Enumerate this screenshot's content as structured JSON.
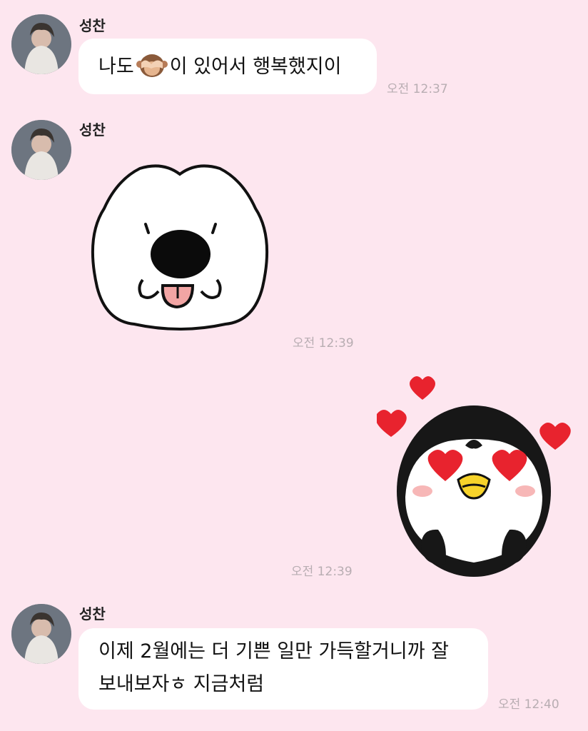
{
  "messages": [
    {
      "sender": "성찬",
      "text_before": "나도",
      "emoji": "see-no-evil-monkey",
      "text_after": "이 있어서 행복했지이",
      "time": "오전 12:37"
    },
    {
      "sender": "성찬",
      "sticker": "white-puppy-tongue-sticker",
      "time": "오전 12:39"
    },
    {
      "sticker": "penguin-heart-eyes-sticker",
      "time": "오전 12:39"
    },
    {
      "sender": "성찬",
      "lines": [
        "이제 2월에는 더 기쁜 일만 가득할거니까 잘",
        "보내보자ㅎ 지금처럼"
      ],
      "time": "오전 12:40"
    }
  ],
  "colors": {
    "background": "#fde6ef",
    "bubble": "#ffffff",
    "time": "#b8adb2",
    "heart": "#e8232e"
  }
}
